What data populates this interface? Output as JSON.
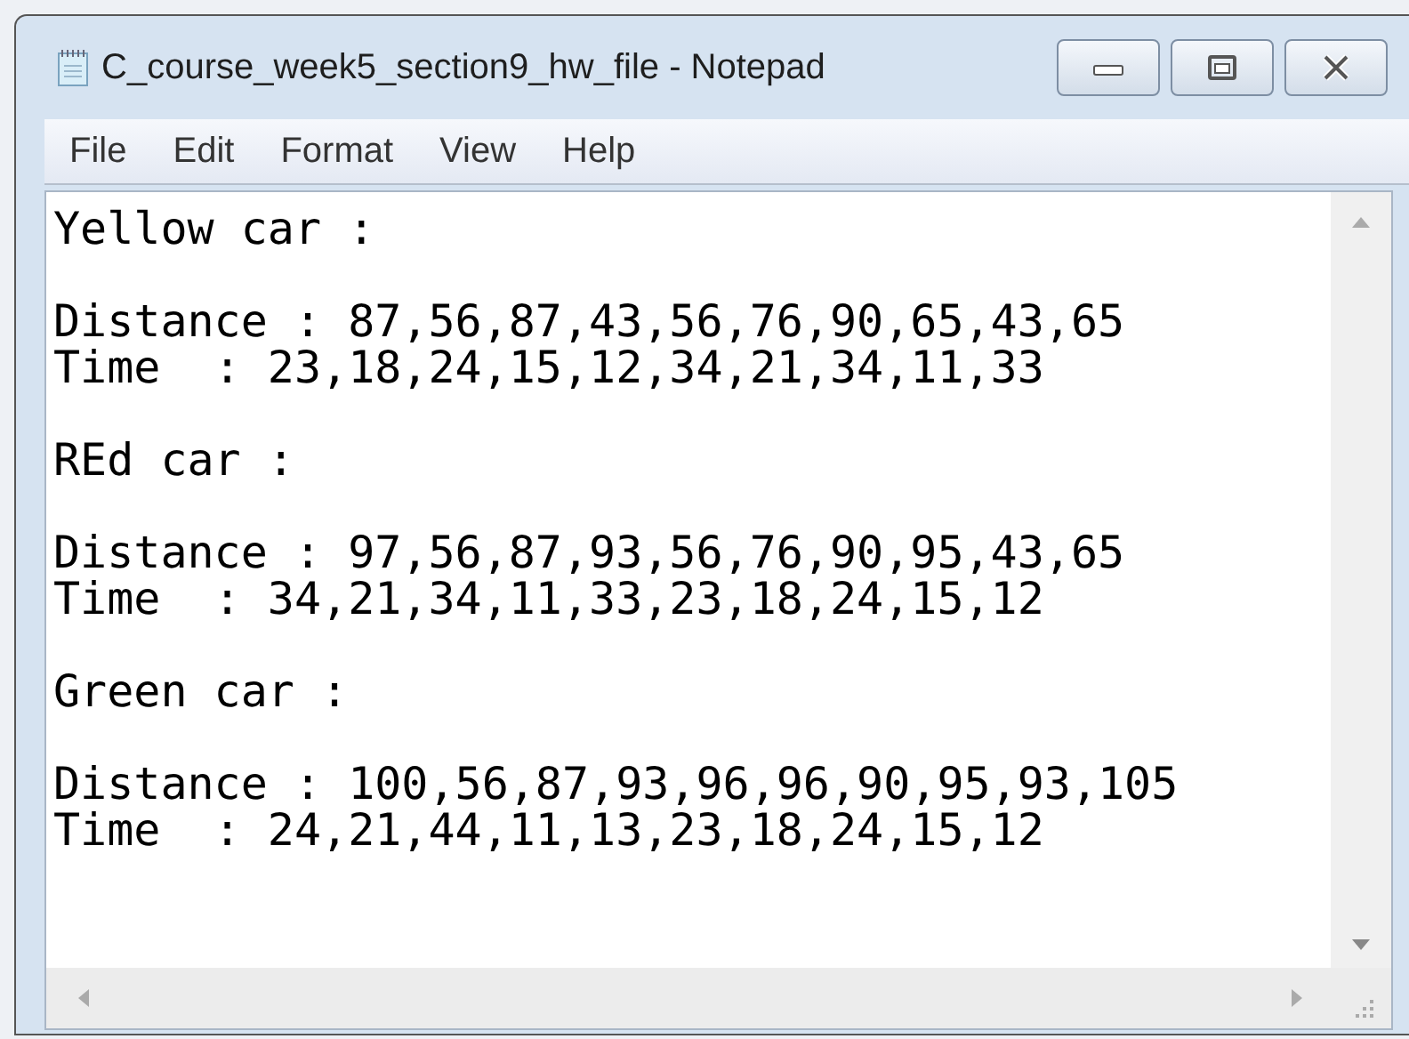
{
  "window": {
    "title": "C_course_week5_section9_hw_file - Notepad"
  },
  "menu": [
    {
      "label": "File"
    },
    {
      "label": "Edit"
    },
    {
      "label": "Format"
    },
    {
      "label": "View"
    },
    {
      "label": "Help"
    }
  ],
  "document": {
    "sections": [
      {
        "heading": "Yellow car :",
        "lines": [
          "Distance : 87,56,87,43,56,76,90,65,43,65",
          "Time  : 23,18,24,15,12,34,21,34,11,33"
        ]
      },
      {
        "heading": "REd car :",
        "lines": [
          "Distance : 97,56,87,93,56,76,90,95,43,65",
          "Time  : 34,21,34,11,33,23,18,24,15,12"
        ]
      },
      {
        "heading": "Green car :",
        "lines": [
          "Distance : 100,56,87,93,96,96,90,95,93,105",
          "Time  : 24,21,44,11,13,23,18,24,15,12"
        ]
      }
    ]
  }
}
